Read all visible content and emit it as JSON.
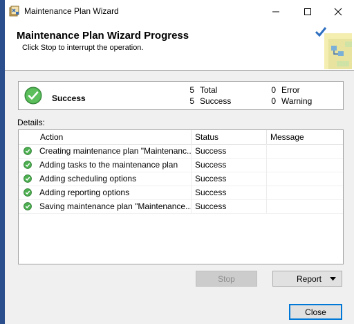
{
  "window": {
    "title": "Maintenance Plan Wizard",
    "controls": {
      "minimize_icon": "minimize-icon",
      "maximize_icon": "maximize-icon",
      "close_icon": "close-icon"
    }
  },
  "header": {
    "title": "Maintenance Plan Wizard Progress",
    "subtitle": "Click Stop to interrupt the operation."
  },
  "summary": {
    "status": "Success",
    "total_count": "5",
    "total_label": "Total",
    "success_count": "5",
    "success_label": "Success",
    "error_count": "0",
    "error_label": "Error",
    "warning_count": "0",
    "warning_label": "Warning"
  },
  "details": {
    "label": "Details:",
    "columns": [
      "Action",
      "Status",
      "Message"
    ],
    "rows": [
      {
        "action": "Creating maintenance plan \"Maintenanc...",
        "status": "Success",
        "message": ""
      },
      {
        "action": "Adding tasks to the maintenance plan",
        "status": "Success",
        "message": ""
      },
      {
        "action": "Adding scheduling options",
        "status": "Success",
        "message": ""
      },
      {
        "action": "Adding reporting options",
        "status": "Success",
        "message": ""
      },
      {
        "action": "Saving maintenance plan \"Maintenance...",
        "status": "Success",
        "message": ""
      }
    ]
  },
  "buttons": {
    "stop": "Stop",
    "report": "Report",
    "close": "Close"
  },
  "colors": {
    "success_green": "#3a9b3a",
    "accent_blue": "#0078d7",
    "window_edge": "#2b4f8c"
  }
}
